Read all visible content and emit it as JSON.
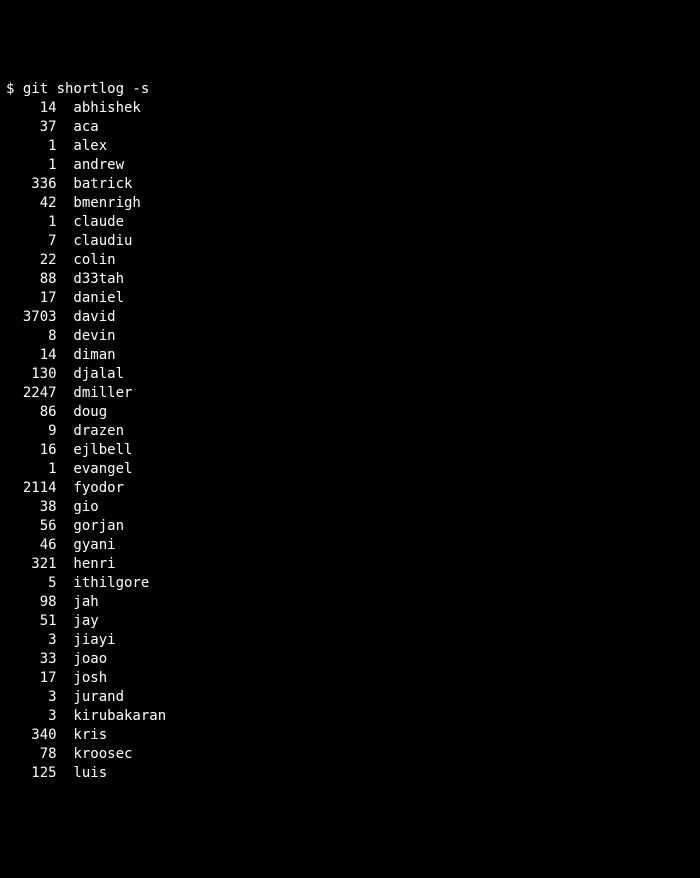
{
  "prompt": "$ git shortlog -s",
  "entries": [
    {
      "count": "14",
      "name": "abhishek"
    },
    {
      "count": "37",
      "name": "aca"
    },
    {
      "count": "1",
      "name": "alex"
    },
    {
      "count": "1",
      "name": "andrew"
    },
    {
      "count": "336",
      "name": "batrick"
    },
    {
      "count": "42",
      "name": "bmenrigh"
    },
    {
      "count": "1",
      "name": "claude"
    },
    {
      "count": "7",
      "name": "claudiu"
    },
    {
      "count": "22",
      "name": "colin"
    },
    {
      "count": "88",
      "name": "d33tah"
    },
    {
      "count": "17",
      "name": "daniel"
    },
    {
      "count": "3703",
      "name": "david"
    },
    {
      "count": "8",
      "name": "devin"
    },
    {
      "count": "14",
      "name": "diman"
    },
    {
      "count": "130",
      "name": "djalal"
    },
    {
      "count": "2247",
      "name": "dmiller"
    },
    {
      "count": "86",
      "name": "doug"
    },
    {
      "count": "9",
      "name": "drazen"
    },
    {
      "count": "16",
      "name": "ejlbell"
    },
    {
      "count": "1",
      "name": "evangel"
    },
    {
      "count": "2114",
      "name": "fyodor"
    },
    {
      "count": "38",
      "name": "gio"
    },
    {
      "count": "56",
      "name": "gorjan"
    },
    {
      "count": "46",
      "name": "gyani"
    },
    {
      "count": "321",
      "name": "henri"
    },
    {
      "count": "5",
      "name": "ithilgore"
    },
    {
      "count": "98",
      "name": "jah"
    },
    {
      "count": "51",
      "name": "jay"
    },
    {
      "count": "3",
      "name": "jiayi"
    },
    {
      "count": "33",
      "name": "joao"
    },
    {
      "count": "17",
      "name": "josh"
    },
    {
      "count": "3",
      "name": "jurand"
    },
    {
      "count": "3",
      "name": "kirubakaran"
    },
    {
      "count": "340",
      "name": "kris"
    },
    {
      "count": "78",
      "name": "kroosec"
    },
    {
      "count": "125",
      "name": "luis"
    }
  ]
}
